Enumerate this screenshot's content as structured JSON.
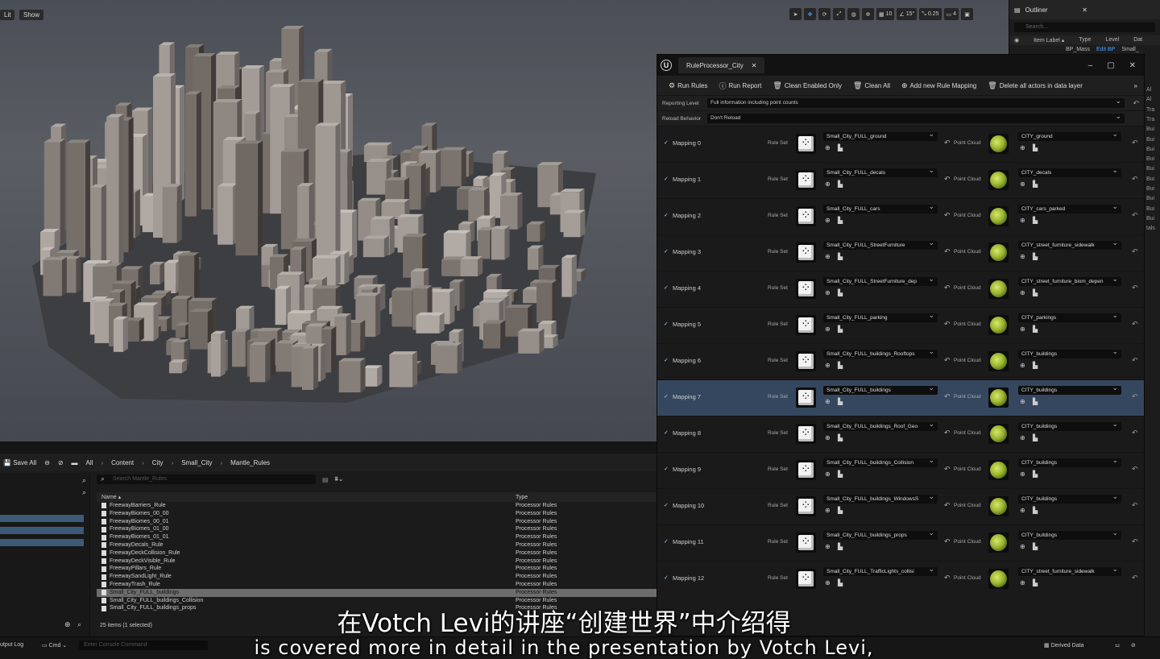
{
  "viewport": {
    "lit_label": "Lit",
    "show_label": "Show",
    "toolbar": {
      "grid": "10",
      "angle": "15°",
      "scale": "0.25",
      "camera": "4"
    }
  },
  "outliner": {
    "title": "Outliner",
    "search_placeholder": "Search...",
    "cols": {
      "label": "Item Label ▴",
      "type": "Type",
      "level": "Level",
      "dat": "Dat"
    },
    "row": {
      "name": "BP_Mass",
      "edit": "Edit BP",
      "small": "Small_"
    },
    "side": [
      "Al",
      "Al",
      "Tra",
      "Tra",
      "Bui",
      "Bui",
      "Bui",
      "Bui",
      "Bui",
      "Bui",
      "Bui",
      "Bui",
      "Bui",
      "Bui",
      "tals"
    ]
  },
  "rule_processor": {
    "tab_title": "RuleProcessor_City",
    "toolbar": {
      "run_rules": "Run Rules",
      "run_report": "Run Report",
      "clean_enabled": "Clean Enabled Only",
      "clean_all": "Clean All",
      "add_mapping": "Add new Rule Mapping",
      "delete_actors": "Delete all actors in data layer"
    },
    "reporting_level": {
      "label": "Reporting Level",
      "value": "Full information including point counts"
    },
    "reload_behavior": {
      "label": "Reload Behavior",
      "value": "Don't Reload"
    },
    "rule_set_label": "Rule Set",
    "point_cloud_label": "Point Cloud",
    "mappings": [
      {
        "name": "Mapping 0",
        "rule_set": "Small_City_FULL_ground",
        "point_cloud": "CITY_ground"
      },
      {
        "name": "Mapping 1",
        "rule_set": "Small_City_FULL_decals",
        "point_cloud": "CITY_decals"
      },
      {
        "name": "Mapping 2",
        "rule_set": "Small_City_FULL_cars",
        "point_cloud": "CITY_cars_parked"
      },
      {
        "name": "Mapping 3",
        "rule_set": "Small_City_FULL_StreetFurniture",
        "point_cloud": "CITY_street_furniture_sidewalk"
      },
      {
        "name": "Mapping 4",
        "rule_set": "Small_City_FULL_StreetFurniture_dep",
        "point_cloud": "CITY_street_furniture_biom_depen"
      },
      {
        "name": "Mapping 5",
        "rule_set": "Small_City_FULL_parking",
        "point_cloud": "CITY_parkings"
      },
      {
        "name": "Mapping 6",
        "rule_set": "Small_City_FULL_buildings_Rooftops",
        "point_cloud": "CITY_buildings"
      },
      {
        "name": "Mapping 7",
        "rule_set": "Small_City_FULL_buildings",
        "point_cloud": "CITY_buildings",
        "selected": true
      },
      {
        "name": "Mapping 8",
        "rule_set": "Small_City_FULL_buildings_Roof_Geo",
        "point_cloud": "CITY_buildings"
      },
      {
        "name": "Mapping 9",
        "rule_set": "Small_City_FULL_buildings_Collision",
        "point_cloud": "CITY_buildings"
      },
      {
        "name": "Mapping 10",
        "rule_set": "Small_City_FULL_buildings_WindowsS",
        "point_cloud": "CITY_buildings"
      },
      {
        "name": "Mapping 11",
        "rule_set": "Small_City_FULL_buildings_props",
        "point_cloud": "CITY_buildings"
      },
      {
        "name": "Mapping 12",
        "rule_set": "Small_City_FULL_TrafficLights_collisi",
        "point_cloud": "CITY_street_furniture_sidewalk"
      }
    ]
  },
  "content_browser": {
    "save_all": "Save All",
    "breadcrumb": [
      "All",
      "Content",
      "City",
      "Small_City",
      "Mantle_Rules"
    ],
    "search_placeholder": "Search Mantle_Rules",
    "col_name": "Name ▴",
    "col_type": "Type",
    "items": [
      {
        "name": "FreewayBarriers_Rule",
        "type": "Processor Rules"
      },
      {
        "name": "FreewayBiomes_00_00",
        "type": "Processor Rules"
      },
      {
        "name": "FreewayBiomes_00_01",
        "type": "Processor Rules"
      },
      {
        "name": "FreewayBiomes_01_00",
        "type": "Processor Rules"
      },
      {
        "name": "FreewayBiomes_01_01",
        "type": "Processor Rules"
      },
      {
        "name": "FreewayDecals_Rule",
        "type": "Processor Rules"
      },
      {
        "name": "FreewayDeckCollision_Rule",
        "type": "Processor Rules"
      },
      {
        "name": "FreewayDeckVisible_Rule",
        "type": "Processor Rules"
      },
      {
        "name": "FreewayPillars_Rule",
        "type": "Processor Rules"
      },
      {
        "name": "FreewaySandLight_Rule",
        "type": "Processor Rules"
      },
      {
        "name": "FreewayTrash_Rule",
        "type": "Processor Rules"
      },
      {
        "name": "Small_City_FULL_buildings",
        "type": "Processor Rules",
        "selected": true
      },
      {
        "name": "Small_City_FULL_buildings_Collision",
        "type": "Processor Rules"
      },
      {
        "name": "Small_City_FULL_buildings_props",
        "type": "Processor Rules"
      }
    ],
    "footer": "25 items (1 selected)"
  },
  "status": {
    "output_log": "utput Log",
    "cmd": "Cmd",
    "console_placeholder": "Enter Console Command",
    "derived_data": "Derived Data"
  },
  "subtitles": {
    "cn": "在Votch Levi的讲座“创建世界”中介绍得",
    "en": "is covered more in detail in the presentation by Votch Levi,"
  }
}
